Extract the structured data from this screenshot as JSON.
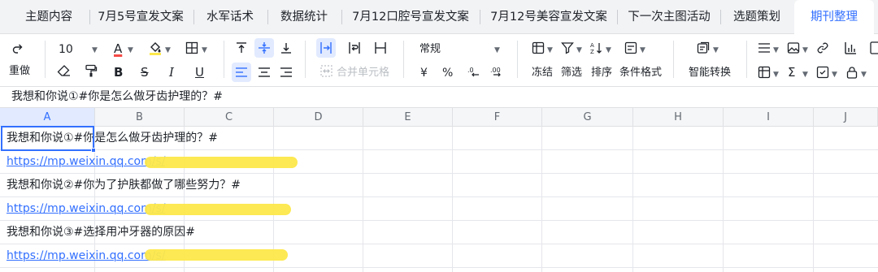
{
  "tabs": [
    {
      "label": "主题内容"
    },
    {
      "label": "7月5号宣发文案"
    },
    {
      "label": "水军话术"
    },
    {
      "label": "数据统计"
    },
    {
      "label": "7月12口腔号宣发文案"
    },
    {
      "label": "7月12号美容宣发文案"
    },
    {
      "label": "下一次主图活动"
    },
    {
      "label": "选题策划"
    },
    {
      "label": "期刊整理"
    }
  ],
  "active_tab": "期刊整理",
  "toolbar": {
    "redo_label": "重做",
    "font_size": "10",
    "merge_cells_label": "合并单元格",
    "number_format": "常规",
    "currency_symbol": "¥",
    "percent_symbol": "%",
    "freeze_label": "冻结",
    "filter_label": "筛选",
    "sort_label": "排序",
    "conditional_format_label": "条件格式",
    "smart_convert_label": "智能转换",
    "bold": "B",
    "italic": "I",
    "underline": "U",
    "strike": "S",
    "font_color_letter": "A",
    "sigma": "Σ"
  },
  "formula_bar": {
    "content": "我想和你说①#你是怎么做牙齿护理的？#"
  },
  "columns": [
    "A",
    "B",
    "C",
    "D",
    "E",
    "F",
    "G",
    "H",
    "I",
    "J"
  ],
  "selected_column": "A",
  "rows": [
    {
      "text": "我想和你说①#你是怎么做牙齿护理的？#",
      "type": "text"
    },
    {
      "text": "https://mp.weixin.qq.com/s/",
      "type": "link"
    },
    {
      "text": "我想和你说②#你为了护肤都做了哪些努力？#",
      "type": "text"
    },
    {
      "text": "https://mp.weixin.qq.com/s/",
      "type": "link"
    },
    {
      "text": "我想和你说③#选择用冲牙器的原因#",
      "type": "text"
    },
    {
      "text": "https://mp.weixin.qq.com/s/",
      "type": "link"
    }
  ],
  "colors": {
    "accent": "#3370ff",
    "highlight": "#fde84a",
    "tab_bar": "#f2f3f5"
  }
}
